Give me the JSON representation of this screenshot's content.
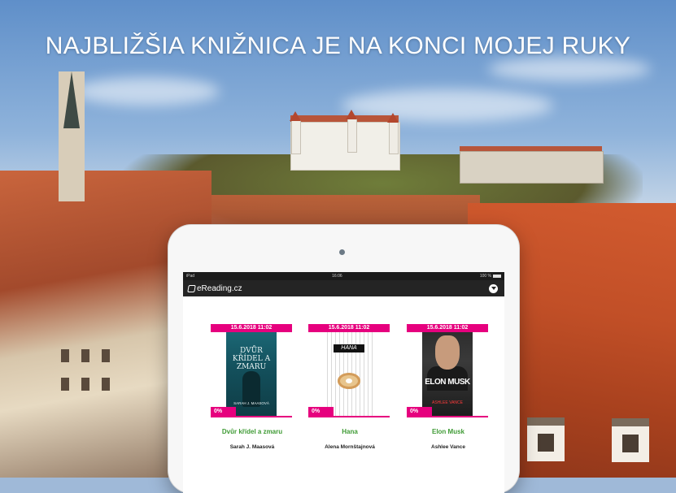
{
  "headline": "NAJBLIŽŠIA KNIŽNICA JE NA KONCI MOJEJ RUKY",
  "tablet": {
    "status_bar": {
      "device": "iPad",
      "time": "16:06",
      "battery": "100 %"
    },
    "app": {
      "brand": "eReading.cz",
      "menu_icon": "chevron-down-circle-icon"
    },
    "books": [
      {
        "date": "15.6.2018 11:02",
        "discount": "0%",
        "title": "Dvůr křídel a zmaru",
        "author": "Sarah J. Maasová",
        "cover_title": "DVŮR KŘÍDEL A ZMARU",
        "cover_author": "SARAH J. MAASOVÁ"
      },
      {
        "date": "15.6.2018 11:02",
        "discount": "0%",
        "title": "Hana",
        "author": "Alena Mornštajnová",
        "cover_title": "HANA"
      },
      {
        "date": "15.6.2018 11:02",
        "discount": "0%",
        "title": "Elon Musk",
        "author": "Ashlee Vance",
        "cover_title": "ELON MUSK",
        "cover_author": "ASHLEE VANCE"
      }
    ]
  },
  "colors": {
    "accent_pink": "#e6007e",
    "title_green": "#3f9b35",
    "navbar": "#242424"
  }
}
